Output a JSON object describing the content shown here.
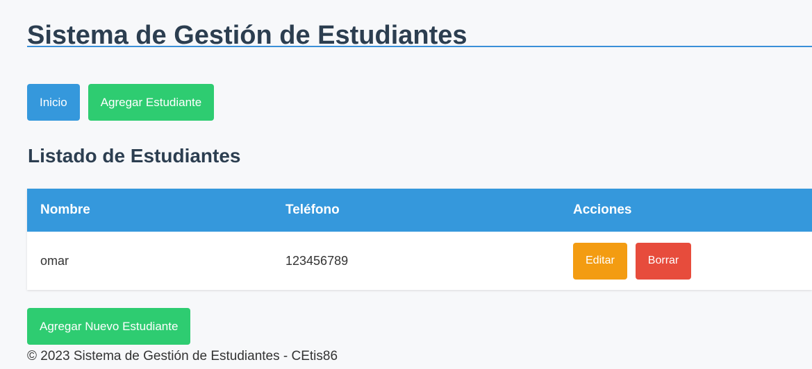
{
  "header": {
    "title": "Sistema de Gestión de Estudiantes"
  },
  "nav": {
    "home_label": "Inicio",
    "add_student_label": "Agregar Estudiante"
  },
  "main": {
    "section_title": "Listado de Estudiantes",
    "table": {
      "columns": [
        "Nombre",
        "Teléfono",
        "Acciones"
      ],
      "rows": [
        {
          "name": "omar",
          "phone": "123456789",
          "edit_label": "Editar",
          "delete_label": "Borrar"
        }
      ]
    },
    "add_new_label": "Agregar Nuevo Estudiante"
  },
  "footer": {
    "text": "© 2023 Sistema de Gestión de Estudiantes - CEtis86"
  },
  "colors": {
    "primary": "#3598dc",
    "success": "#2ecc71",
    "warning": "#f39c12",
    "danger": "#e74c3c",
    "heading": "#2c3e50"
  }
}
